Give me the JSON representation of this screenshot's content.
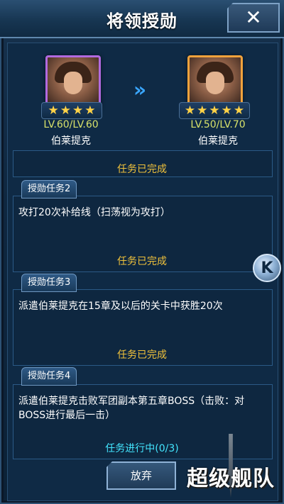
{
  "window": {
    "title": "将领授勋",
    "close_label": "✕"
  },
  "promotion": {
    "from": {
      "level": "LV.60/LV.60",
      "name": "伯莱提克",
      "stars": 4
    },
    "to": {
      "level": "LV.50/LV.70",
      "name": "伯莱提克",
      "stars": 5
    },
    "arrow_glyph": "»"
  },
  "tasks": {
    "task1": {
      "status": "任务已完成"
    },
    "task2": {
      "tab": "授勋任务2",
      "desc": "攻打20次补给线（扫荡视为攻打）",
      "status": "任务已完成"
    },
    "task3": {
      "tab": "授勋任务3",
      "desc": "派遣伯莱提克在15章及以后的关卡中获胜20次",
      "status": "任务已完成"
    },
    "task4": {
      "tab": "授勋任务4",
      "desc": "派遣伯莱提克击败军团副本第五章BOSS（击败：对BOSS进行最后一击）",
      "status": "任务进行中(0/3)"
    }
  },
  "side_button": {
    "label": "K"
  },
  "footer": {
    "give_up_label": "放弃"
  },
  "logo": {
    "text": "超级舰队"
  },
  "colors": {
    "done": "#f0c23b",
    "progress": "#43e6ff",
    "accent": "#3aa7ff"
  }
}
